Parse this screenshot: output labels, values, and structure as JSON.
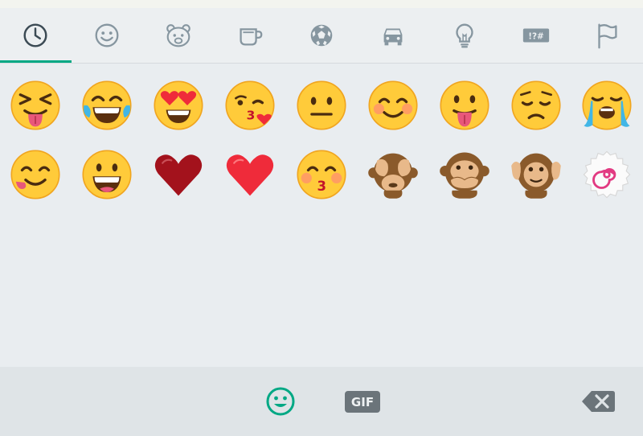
{
  "categories": [
    {
      "name": "recent",
      "icon": "clock-icon",
      "active": true
    },
    {
      "name": "smileys",
      "icon": "smiley-icon",
      "active": false
    },
    {
      "name": "animals",
      "icon": "bear-icon",
      "active": false
    },
    {
      "name": "food",
      "icon": "cup-icon",
      "active": false
    },
    {
      "name": "activities",
      "icon": "soccer-ball-icon",
      "active": false
    },
    {
      "name": "travel",
      "icon": "car-icon",
      "active": false
    },
    {
      "name": "objects",
      "icon": "lightbulb-icon",
      "active": false
    },
    {
      "name": "symbols",
      "icon": "symbols-icon",
      "label": "!?#",
      "active": false
    },
    {
      "name": "flags",
      "icon": "flag-icon",
      "active": false
    }
  ],
  "recent_emojis": [
    [
      "squinting-face-with-tongue",
      "face-with-tears-of-joy",
      "smiling-face-with-heart-eyes",
      "face-blowing-a-kiss",
      "neutral-face",
      "smiling-face-with-smiling-eyes",
      "face-with-tongue",
      "pensive-face",
      "loudly-crying-face"
    ],
    [
      "face-savoring-food",
      "grinning-face-with-smiling-eyes",
      "dark-red-heart",
      "red-heart",
      "kissing-face-with-smiling-eyes",
      "see-no-evil-monkey",
      "speak-no-evil-monkey",
      "hear-no-evil-monkey",
      "fish-cake-with-swirl"
    ]
  ],
  "bottom_bar": {
    "emoji_tab_icon": "smiley-icon",
    "gif_label": "GIF",
    "backspace_icon": "backspace-icon"
  },
  "colors": {
    "accent": "#00a884",
    "icon_gray": "#8696a0",
    "background": "#e9edf0"
  }
}
